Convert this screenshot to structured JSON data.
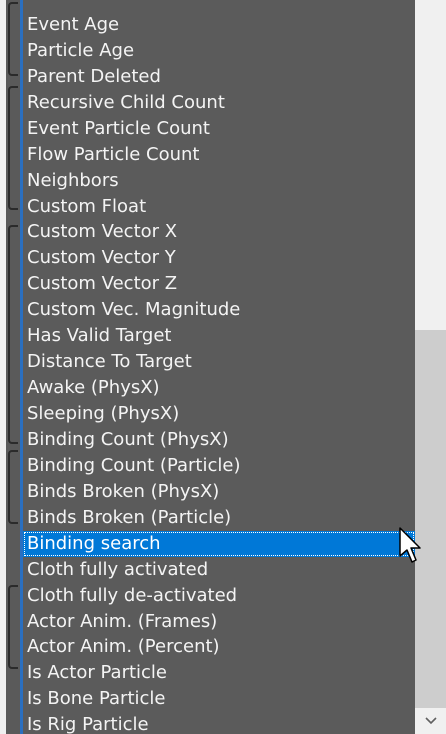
{
  "list": {
    "items": [
      "Event Age",
      "Particle Age",
      "Parent Deleted",
      "Recursive Child Count",
      "Event Particle Count",
      "Flow Particle Count",
      "Neighbors",
      "Custom Float",
      "Custom Vector X",
      "Custom Vector Y",
      "Custom Vector Z",
      "Custom Vec. Magnitude",
      "Has Valid Target",
      "Distance To Target",
      "Awake (PhysX)",
      "Sleeping (PhysX)",
      "Binding Count (PhysX)",
      "Binding Count (Particle)",
      "Binds Broken (PhysX)",
      "Binds Broken (Particle)",
      "Binding search",
      "Cloth fully activated",
      "Cloth fully de-activated",
      "Actor Anim. (Frames)",
      "Actor Anim. (Percent)",
      "Is Actor Particle",
      "Is Bone Particle",
      "Is Rig Particle"
    ],
    "selected_item": "Binding search"
  },
  "scrollbar": {
    "down_arrow_icon": "chevron-down-icon"
  },
  "colors": {
    "list_background": "#5b5b5b",
    "selection": "#0078d7",
    "text": "#f4f4f4"
  }
}
